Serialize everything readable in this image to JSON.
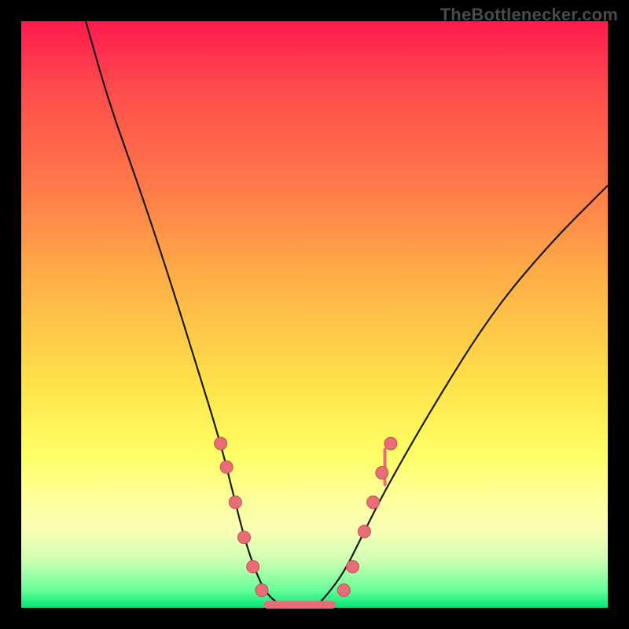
{
  "watermark": "TheBottlenecker.com",
  "chart_data": {
    "type": "line",
    "title": "",
    "xlabel": "",
    "ylabel": "",
    "xlim": [
      0,
      100
    ],
    "ylim": [
      0,
      100
    ],
    "notes": "V-shaped bottleneck curve. X roughly maps to relative component performance; Y to bottleneck percentage (0 at bottom / green = no bottleneck). No numeric axis ticks are shown in the image; values are read from pixel positions and normalized to 0–100.",
    "series": [
      {
        "name": "bottleneck-curve",
        "x": [
          11,
          15,
          20,
          25,
          30,
          34,
          36,
          38,
          40,
          42,
          45,
          48,
          50,
          52,
          55,
          58,
          62,
          70,
          80,
          90,
          100
        ],
        "y": [
          100,
          86,
          72,
          57,
          41,
          28,
          20,
          12,
          6,
          2,
          0,
          0,
          0,
          2,
          6,
          12,
          20,
          34,
          50,
          62,
          72
        ]
      }
    ],
    "markers": {
      "name": "highlighted-points",
      "note": "Pink circular markers clustered near the valley on both sides of the curve.",
      "points": [
        {
          "x": 34,
          "y": 28
        },
        {
          "x": 35,
          "y": 24
        },
        {
          "x": 36.5,
          "y": 18
        },
        {
          "x": 38,
          "y": 12
        },
        {
          "x": 39.5,
          "y": 7
        },
        {
          "x": 41,
          "y": 3
        },
        {
          "x": 55,
          "y": 3
        },
        {
          "x": 56.5,
          "y": 7
        },
        {
          "x": 58.5,
          "y": 13
        },
        {
          "x": 60,
          "y": 18
        },
        {
          "x": 61.5,
          "y": 23
        },
        {
          "x": 63,
          "y": 28
        }
      ]
    },
    "valley_flat": {
      "x_start": 42,
      "x_end": 53,
      "y": 0.5
    },
    "spike": {
      "x": 62,
      "y_top": 27,
      "y_bottom": 21
    },
    "colors": {
      "curve": "#1a1a1a",
      "markers": "#e86d76",
      "background_top": "#ff1a4d",
      "background_bottom": "#00e676",
      "frame": "#000000"
    }
  }
}
